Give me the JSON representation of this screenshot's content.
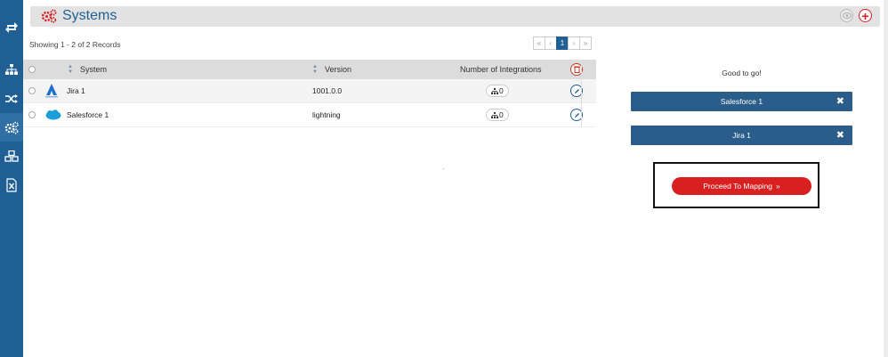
{
  "sidebar": {
    "items": [
      {
        "icon": "sync-icon"
      },
      {
        "icon": "hierarchy-icon"
      },
      {
        "icon": "shuffle-icon"
      },
      {
        "icon": "gears-icon"
      },
      {
        "icon": "cubes-icon"
      },
      {
        "icon": "excel-file-icon"
      }
    ],
    "active_index": 3,
    "color": "#1f5f93"
  },
  "header": {
    "title": "Systems",
    "accent_color": "#d61f26",
    "add_label": "+"
  },
  "records": {
    "text": "Showing 1 - 2 of 2 Records"
  },
  "pagination": {
    "first": "«",
    "prev": "‹",
    "current": "1",
    "next": "›",
    "last": "»"
  },
  "table": {
    "columns": {
      "system": "System",
      "version": "Version",
      "integrations": "Number of Integrations"
    },
    "rows": [
      {
        "system": "Jira 1",
        "logo": "jira-logo",
        "version": "1001.0.0",
        "integrations": "0"
      },
      {
        "system": "Salesforce 1",
        "logo": "salesforce-logo",
        "version": "lightning",
        "integrations": "0"
      }
    ]
  },
  "selection": {
    "status": "Good to go!",
    "chips": [
      {
        "label": "Salesforce 1",
        "remove": "✖"
      },
      {
        "label": "Jira 1",
        "remove": "✖"
      }
    ],
    "proceed_label": "Proceed To Mapping",
    "proceed_arrow": "»",
    "proceed_color": "#d92020"
  }
}
